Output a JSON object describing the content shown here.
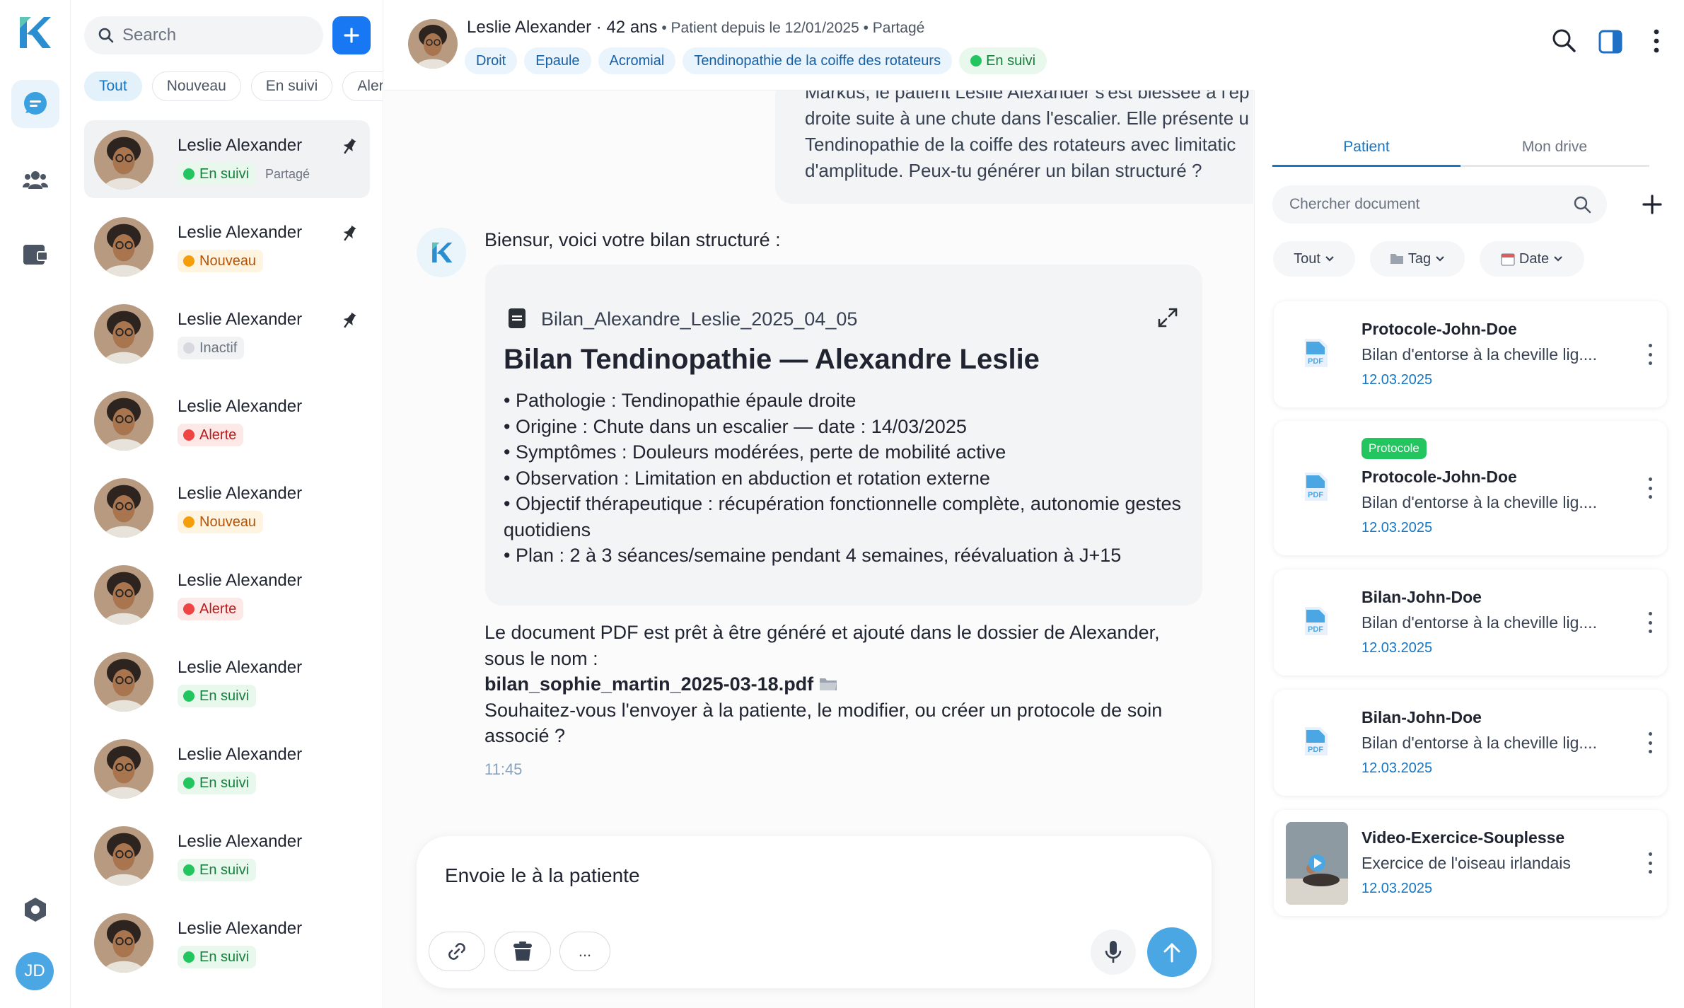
{
  "sidebar_rail": {
    "user_initials": "JD",
    "icons": [
      "logo-icon",
      "chat-icon",
      "patients-icon",
      "folder-icon",
      "settings-icon"
    ]
  },
  "conversation_list": {
    "search_placeholder": "Search",
    "filters": [
      {
        "label": "Tout",
        "active": true
      },
      {
        "label": "Nouveau",
        "active": false
      },
      {
        "label": "En suivi",
        "active": false
      },
      {
        "label": "Alerte",
        "active": false
      }
    ],
    "items": [
      {
        "name": "Leslie Alexander",
        "status": "En suivi",
        "shared": "Partagé",
        "pinned": true
      },
      {
        "name": "Leslie Alexander",
        "status": "Nouveau",
        "shared": "",
        "pinned": true
      },
      {
        "name": "Leslie Alexander",
        "status": "Inactif",
        "shared": "",
        "pinned": true
      },
      {
        "name": "Leslie Alexander",
        "status": "Alerte",
        "shared": "",
        "pinned": false
      },
      {
        "name": "Leslie Alexander",
        "status": "Nouveau",
        "shared": "",
        "pinned": false
      },
      {
        "name": "Leslie Alexander",
        "status": "Alerte",
        "shared": "",
        "pinned": false
      },
      {
        "name": "Leslie Alexander",
        "status": "En suivi",
        "shared": "",
        "pinned": false
      },
      {
        "name": "Leslie Alexander",
        "status": "En suivi",
        "shared": "",
        "pinned": false
      },
      {
        "name": "Leslie Alexander",
        "status": "En suivi",
        "shared": "",
        "pinned": false
      },
      {
        "name": "Leslie Alexander",
        "status": "En suivi",
        "shared": "",
        "pinned": false
      }
    ]
  },
  "chat": {
    "header": {
      "name_age": "Leslie Alexander · 42 ans",
      "meta": " • Patient depuis le 12/01/2025 • Partagé",
      "tags": [
        "Droit",
        "Epaule",
        "Acromial",
        "Tendinopathie de la coiffe des rotateurs"
      ],
      "status": "En suivi"
    },
    "previous_message_lines": [
      "Markus, le patient Leslie Alexander s'est blessée à l'ep",
      "droite suite à une chute dans l'escalier. Elle présente u",
      "Tendinopathie de la coiffe des rotateurs avec limitatic",
      "d'amplitude. Peux-tu générer un bilan structuré ?"
    ],
    "bot_intro": "Biensur, voici votre bilan structuré :",
    "document": {
      "filename": "Bilan_Alexandre_Leslie_2025_04_05",
      "title": "Bilan Tendinopathie — Alexandre Leslie",
      "lines": [
        "• Pathologie : Tendinopathie épaule droite",
        "• Origine : Chute dans un escalier — date : 14/03/2025",
        "• Symptômes : Douleurs modérées, perte de mobilité active",
        "• Observation : Limitation en abduction et rotation externe",
        "• Objectif thérapeutique : récupération fonctionnelle complète, autonomie gestes quotidiens",
        "• Plan : 2 à 3 séances/semaine pendant 4 semaines, réévaluation à J+15"
      ]
    },
    "follow_up": {
      "line1": "Le document PDF est prêt à être généré et ajouté dans le dossier de Alexander, sous le nom :",
      "file": "bilan_sophie_martin_2025-03-18.pdf",
      "line2": "Souhaitez-vous l'envoyer à la patiente, le modifier, ou créer un protocole de soin associé ?"
    },
    "timestamp": "11:45",
    "composer": {
      "value": "Envoie le à la patiente",
      "more_label": "..."
    }
  },
  "right_panel": {
    "tabs": [
      {
        "label": "Patient",
        "active": true
      },
      {
        "label": "Mon drive",
        "active": false
      }
    ],
    "search_placeholder": "Chercher document",
    "filters": [
      "Tout",
      "Tag",
      "Date"
    ],
    "documents": [
      {
        "title": "Protocole-John-Doe",
        "desc": "Bilan d'entorse à la cheville lig....",
        "date": "12.03.2025",
        "tag": "",
        "kind": "pdf"
      },
      {
        "title": "Protocole-John-Doe",
        "desc": "Bilan d'entorse à la cheville lig....",
        "date": "12.03.2025",
        "tag": "Protocole",
        "kind": "pdf"
      },
      {
        "title": "Bilan-John-Doe",
        "desc": "Bilan d'entorse à la cheville lig....",
        "date": "12.03.2025",
        "tag": "",
        "kind": "pdf"
      },
      {
        "title": "Bilan-John-Doe",
        "desc": "Bilan d'entorse à la cheville lig....",
        "date": "12.03.2025",
        "tag": "",
        "kind": "pdf"
      },
      {
        "title": "Video-Exercice-Souplesse",
        "desc": "Exercice de l'oiseau irlandais",
        "date": "12.03.2025",
        "tag": "",
        "kind": "video"
      }
    ],
    "pdf_label": "PDF"
  },
  "colors": {
    "accent": "#1676c4",
    "primary_button": "#1877f2",
    "send_button": "#4aa7e3",
    "status_suivi": "#22c55e",
    "status_nouveau": "#f59e0b",
    "status_alerte": "#ef4444"
  }
}
